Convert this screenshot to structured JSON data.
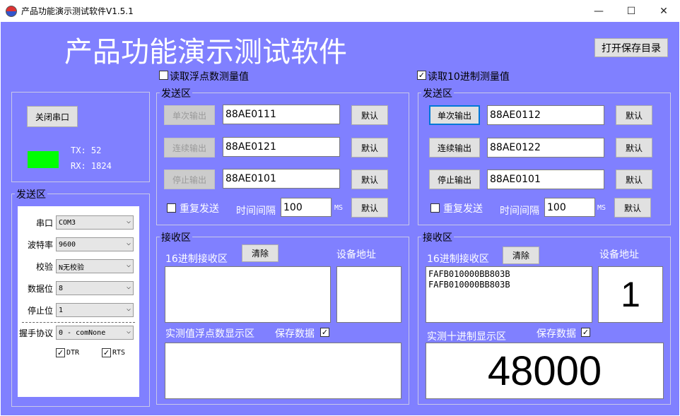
{
  "window": {
    "title": "产品功能演示测试软件V1.5.1",
    "min": "—",
    "max": "☐",
    "close": "✕"
  },
  "header": {
    "big_title": "产品功能演示测试软件",
    "open_dir_button": "打开保存目录"
  },
  "left": {
    "float_check_label": "读取浮点数测量值",
    "float_checked": false
  },
  "right": {
    "dec_check_label": "读取10进制测量值",
    "dec_checked": true
  },
  "port_box": {
    "close_port_button": "关闭串口",
    "indicator_color": "#00ff00",
    "tx": "TX: 52",
    "rx": "RX: 1824"
  },
  "serial_cfg": {
    "title": "发送区",
    "port_label": "串口",
    "port_value": "COM3",
    "baud_label": "波特率",
    "baud_value": "9600",
    "parity_label": "校验",
    "parity_value": "N无校验",
    "databits_label": "数据位",
    "databits_value": "8",
    "stopbits_label": "停止位",
    "stopbits_value": "1",
    "handshake_label": "握手协议",
    "handshake_value": "0 - comNone",
    "dtr_label": "DTR",
    "rts_label": "RTS"
  },
  "send_left": {
    "title": "发送区",
    "single_button": "单次输出",
    "single_cmd": "88AE0111",
    "single_default": "默认",
    "cont_button": "连续输出",
    "cont_cmd": "88AE0121",
    "cont_default": "默认",
    "stop_button": "停止输出",
    "stop_cmd": "88AE0101",
    "stop_default": "默认",
    "repeat_label": "重复发送",
    "interval_label": "时间间隔",
    "interval_value": "100",
    "ms": "MS",
    "interval_default": "默认"
  },
  "send_right": {
    "title": "发送区",
    "single_button": "单次输出",
    "single_cmd": "88AE0112",
    "single_default": "默认",
    "cont_button": "连续输出",
    "cont_cmd": "88AE0122",
    "cont_default": "默认",
    "stop_button": "停止输出",
    "stop_cmd": "88AE0101",
    "stop_default": "默认",
    "repeat_label": "重复发送",
    "interval_label": "时间间隔",
    "interval_value": "100",
    "ms": "MS",
    "interval_default": "默认"
  },
  "recv_left": {
    "title": "接收区",
    "hex_label": "16进制接收区",
    "clear_button": "清除",
    "addr_label": "设备地址",
    "hex_content": "",
    "addr_value": "",
    "float_label": "实测值浮点数显示区",
    "save_label": "保存数据",
    "save_checked": true,
    "float_value": ""
  },
  "recv_right": {
    "title": "接收区",
    "hex_label": "16进制接收区",
    "clear_button": "清除",
    "addr_label": "设备地址",
    "hex_content": "FAFB010000BB803B\nFAFB010000BB803B",
    "addr_value": "1",
    "dec_label": "实测十进制显示区",
    "save_label": "保存数据",
    "save_checked": true,
    "dec_value": "48000"
  }
}
